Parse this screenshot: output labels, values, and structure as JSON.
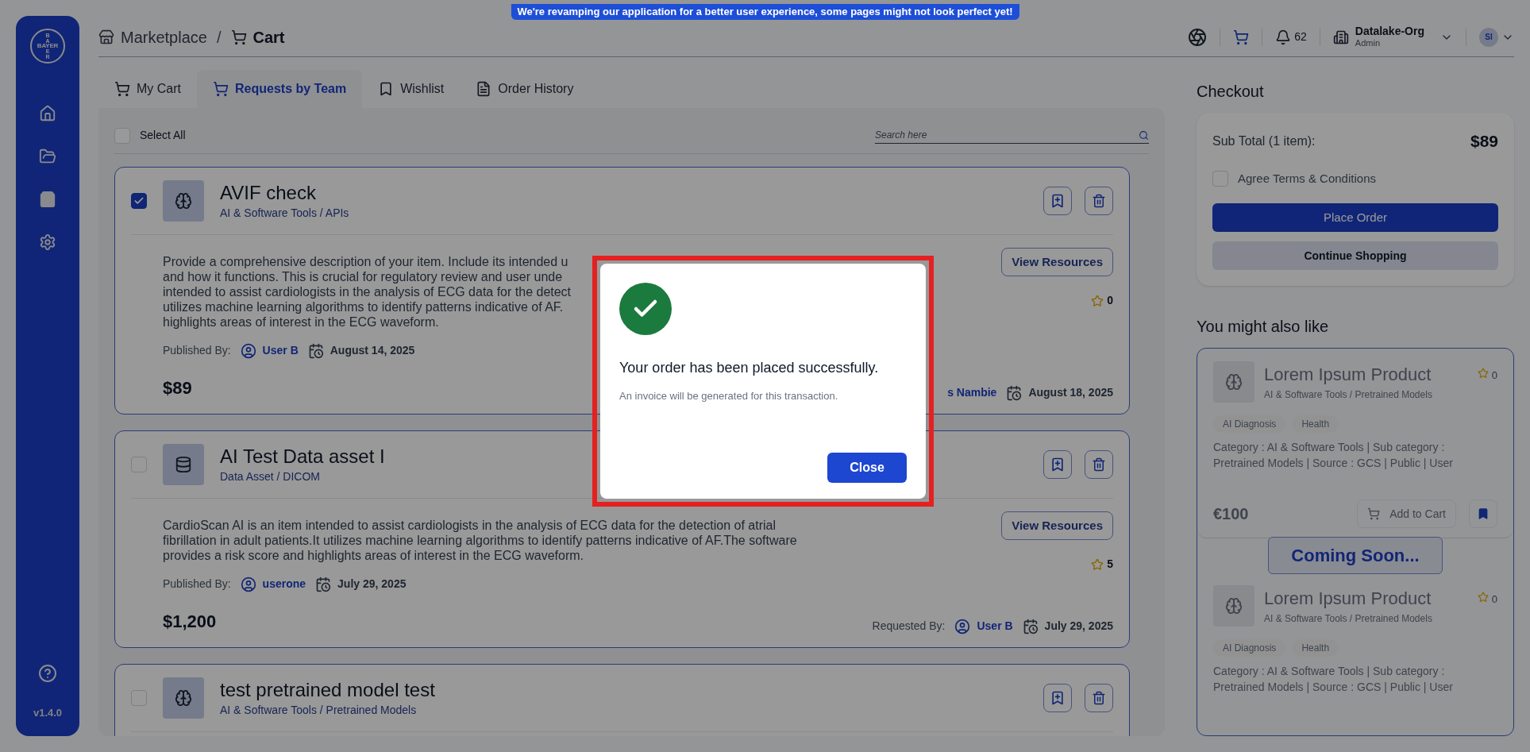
{
  "banner": "We're revamping our application for a better user experience, some pages might not look perfect yet!",
  "sidebar": {
    "logo": {
      "top": "BA",
      "middle": "BAYER",
      "bottom": "ER"
    },
    "items": [
      {
        "kind": "home",
        "selected": false
      },
      {
        "kind": "folder",
        "selected": false
      },
      {
        "kind": "bag",
        "selected": true
      },
      {
        "kind": "settings",
        "selected": false
      }
    ],
    "version": "v1.4.0"
  },
  "header": {
    "breadcrumb": [
      "Marketplace",
      "/",
      "Cart"
    ],
    "notifications": "62",
    "org": "Datalake-Org",
    "role": "Admin",
    "avatar": "SI"
  },
  "tabs": [
    {
      "label": "My Cart",
      "kind": "cart",
      "selected": false
    },
    {
      "label": "Requests by Team",
      "kind": "cart",
      "selected": true
    },
    {
      "label": "Wishlist",
      "kind": "bookmark",
      "selected": false
    },
    {
      "label": "Order History",
      "kind": "history",
      "selected": false
    }
  ],
  "select_all": {
    "label": "Select All",
    "checked": false
  },
  "search": {
    "placeholder": "Search here"
  },
  "items": [
    {
      "title": "AVIF check",
      "category": "AI & Software Tools / APIs",
      "kind": "ai",
      "checked": true,
      "description_lines": [
        "Provide a comprehensive description of your item. Include its intended u",
        "and how it functions. This is crucial for regulatory review and user unde",
        "intended to assist cardiologists in the analysis of ECG data for the detect",
        "utilizes machine learning algorithms to identify patterns indicative of AF.",
        "highlights areas of interest in the ECG waveform."
      ],
      "published_label": "Published By:",
      "publisher": "User B",
      "published_date": "August 14, 2025",
      "view_button": "View Resources",
      "rating": "0",
      "price": "$89",
      "requester": "s Nambie",
      "requested_date": "August 18, 2025"
    },
    {
      "title": "AI Test Data asset I",
      "category": "Data Asset / DICOM",
      "kind": "data",
      "checked": false,
      "description_lines": [
        "CardioScan AI is an item intended to assist cardiologists in the analysis of ECG data for the detection of atrial",
        "fibrillation in adult patients.It utilizes machine learning algorithms to identify patterns indicative of AF.The software",
        "provides a risk score and highlights areas of interest in the ECG waveform."
      ],
      "published_label": "Published By:",
      "publisher": "userone",
      "published_date": "July 29, 2025",
      "view_button": "View Resources",
      "rating": "5",
      "price": "$1,200",
      "requested_label": "Requested By:",
      "requester": "User B",
      "requested_date": "July 29, 2025"
    },
    {
      "title": "test pretrained model test",
      "category": "AI & Software Tools / Pretrained Models",
      "kind": "ai",
      "checked": false
    }
  ],
  "checkout": {
    "title": "Checkout",
    "subtotal_label": "Sub Total (1 item):",
    "subtotal": "$89",
    "agree": {
      "label": "Agree Terms & Conditions",
      "checked": false
    },
    "place_order": "Place Order",
    "continue": "Continue Shopping"
  },
  "recommendations": {
    "title": "You might also like",
    "coming_soon": "Coming Soon...",
    "cards": [
      {
        "title": "Lorem Ipsum Product",
        "category": "AI & Software Tools / Pretrained Models",
        "rating": "0",
        "tags": [
          "AI Diagnosis",
          "Health"
        ],
        "details": "Category : AI & Software Tools | Sub category : Pretrained Models | Source : GCS | Public | User",
        "price": "€100",
        "add_button": "Add to Cart"
      },
      {
        "title": "Lorem Ipsum Product",
        "category": "AI & Software Tools / Pretrained Models",
        "rating": "0",
        "tags": [
          "AI Diagnosis",
          "Health"
        ],
        "details": "Category : AI & Software Tools | Sub category : Pretrained Models | Source : GCS | Public | User"
      }
    ]
  },
  "modal": {
    "message": "Your order has been placed successfully.",
    "note": "An invoice will be generated for this transaction.",
    "close": "Close"
  }
}
